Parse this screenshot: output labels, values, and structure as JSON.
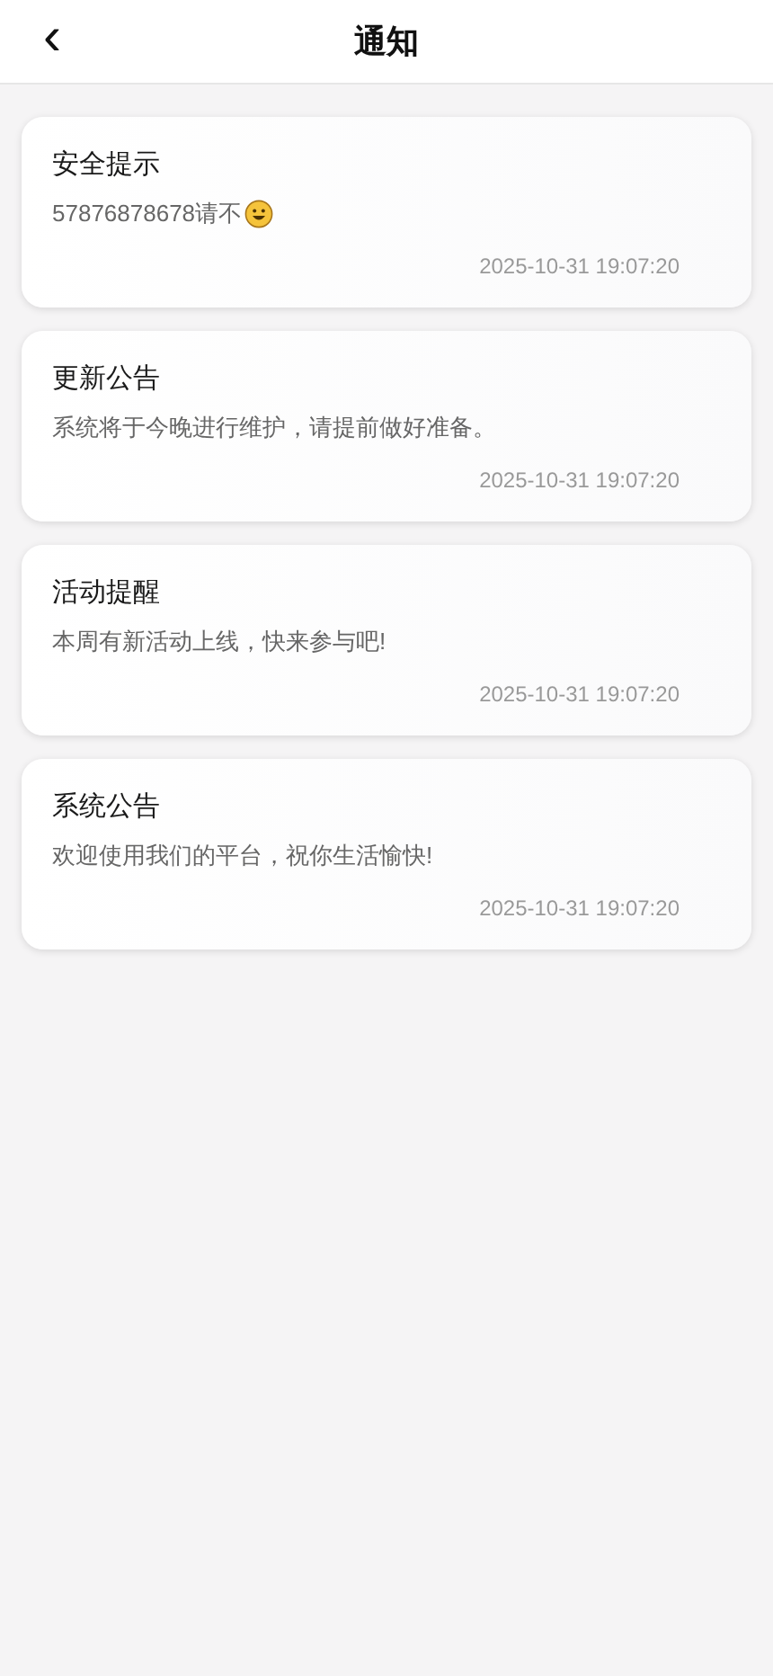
{
  "header": {
    "back_icon": "‹",
    "title": "通知"
  },
  "notifications": [
    {
      "title": "安全提示",
      "message": "57876878678请不",
      "emoji": true,
      "time": "2025-10-31 19:07:20"
    },
    {
      "title": "更新公告",
      "message": "系统将于今晚进行维护，请提前做好准备。",
      "emoji": false,
      "time": "2025-10-31 19:07:20"
    },
    {
      "title": "活动提醒",
      "message": "本周有新活动上线，快来参与吧!",
      "emoji": false,
      "time": "2025-10-31 19:07:20"
    },
    {
      "title": "系统公告",
      "message": "欢迎使用我们的平台，祝你生活愉快!",
      "emoji": false,
      "time": "2025-10-31 19:07:20"
    }
  ]
}
